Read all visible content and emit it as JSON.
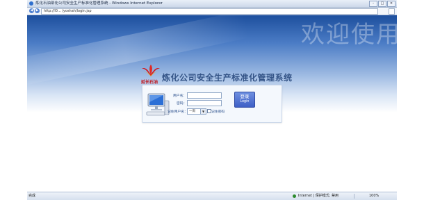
{
  "window": {
    "title": "炼化石油部化公司安全生产标准化管理系统 - Windows Internet Explorer",
    "controls": [
      "-",
      "□",
      "×"
    ]
  },
  "address_bar": {
    "url": "http://l0... /yoshah/login.jsp"
  },
  "page": {
    "welcome": "欢迎使用",
    "logo_text": "延长石油",
    "system_title": "炼化公司安全生产标准化管理系统",
    "form": {
      "username_label": "用户名：",
      "password_label": "密码：",
      "remember_label": "记住用户名：",
      "remember_value": "一周",
      "remember_password_label": "记住密码",
      "login_cn": "登录",
      "login_en": "Login"
    }
  },
  "status_bar": {
    "left": "完成",
    "zone": "Internet | 保护模式: 禁用",
    "zoom": "100%"
  },
  "colors": {
    "header_blue": "#1d4f9e",
    "title_blue": "#345487",
    "login_button": "#4e6fd0",
    "logo_red": "#c0171d"
  }
}
